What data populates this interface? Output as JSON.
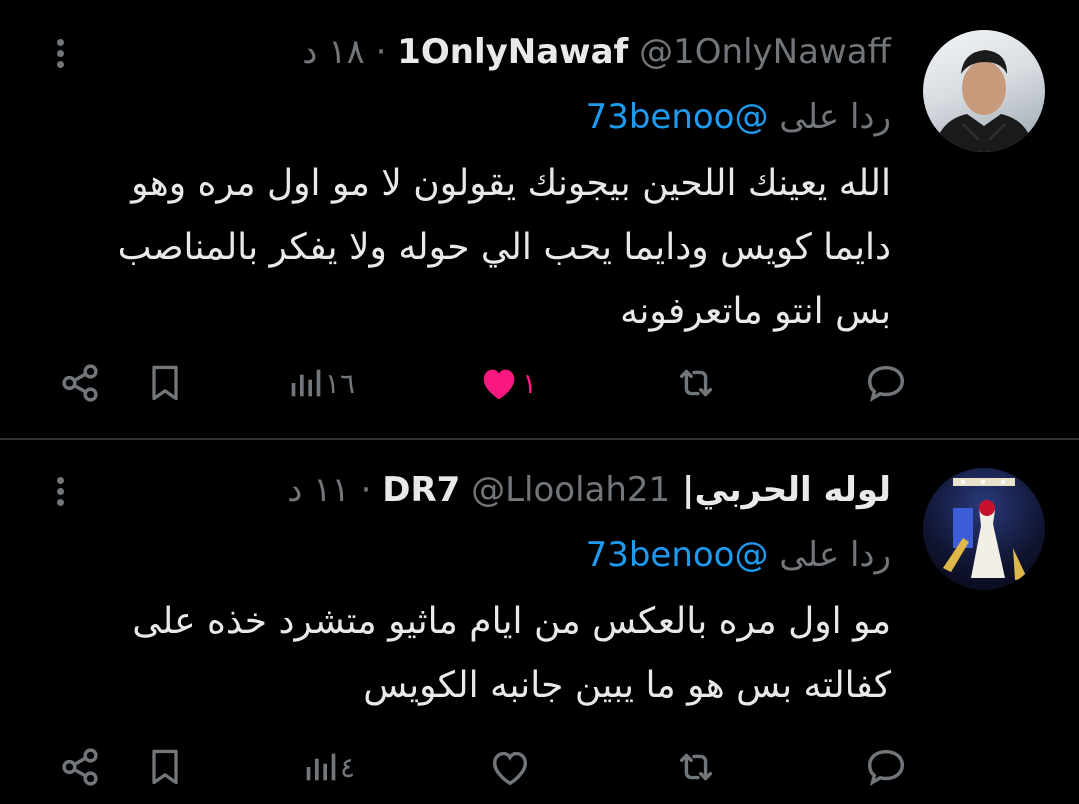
{
  "tweets": [
    {
      "display_name": "1OnlyNawaf",
      "handle": "@1OnlyNawaff",
      "separator": "·",
      "time": "١٨ د",
      "reply_prefix": "ردا على",
      "reply_to": "@73benoo",
      "text": "الله يعينك اللحين بيجونك يقولون لا مو اول مره وهو دايما كويس ودايما يحب الي حوله ولا يفكر بالمناصب بس انتو ماتعرفونه",
      "views": "١٦",
      "likes": "١",
      "liked": true,
      "like_color": "#f91880"
    },
    {
      "display_name": "لوله الحربي| DR7",
      "handle": "@Lloolah21",
      "separator": "·",
      "time": "١١ د",
      "reply_prefix": "ردا على",
      "reply_to": "@73benoo",
      "text": "مو اول مره بالعكس من ايام ماثيو متشرد خذه على كفالته بس هو ما يبين جانبه الكويس",
      "views": "٤",
      "likes": "",
      "liked": false
    }
  ],
  "icons": {
    "reply": "reply-icon",
    "retweet": "retweet-icon",
    "like": "heart-icon",
    "views": "views-icon",
    "bookmark": "bookmark-icon",
    "share": "share-icon",
    "more": "more-vertical-icon"
  },
  "colors": {
    "background": "#000000",
    "link": "#1d9bf0",
    "muted": "#71767b",
    "divider": "#2f3336"
  }
}
